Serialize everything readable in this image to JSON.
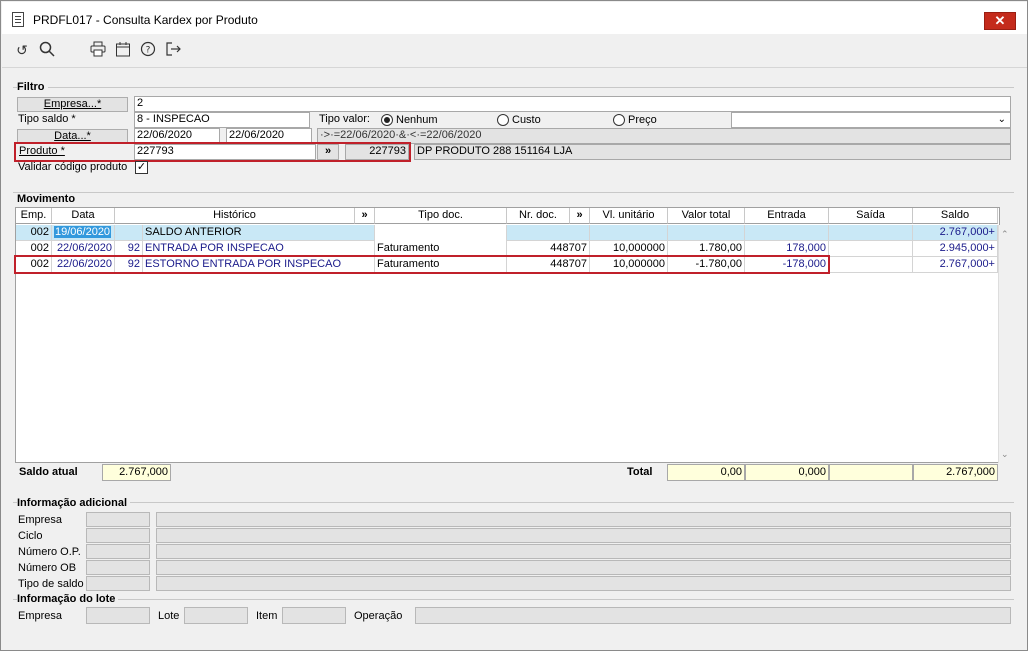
{
  "window": {
    "title": "PRDFL017 - Consulta Kardex por Produto",
    "close_glyph": "✕"
  },
  "toolbar": {
    "icons": [
      "undo-icon",
      "search-icon",
      "print-icon",
      "calendar-icon",
      "help-icon",
      "exit-icon"
    ]
  },
  "filtro": {
    "section_label": "Filtro",
    "empresa_button": "Empresa...*",
    "empresa_value": "2",
    "tipo_saldo_label": "Tipo saldo *",
    "tipo_saldo_value": "8 - INSPECAO",
    "tipo_valor_label": "Tipo valor:",
    "tipo_valor_options": [
      "Nenhum",
      "Custo",
      "Preço"
    ],
    "tipo_valor_selected": "Nenhum",
    "data_button": "Data...*",
    "data_inicio": "22/06/2020",
    "data_fim": "22/06/2020",
    "data_expr": "·>·=22/06/2020·&·<·=22/06/2020",
    "produto_label": "Produto *",
    "produto_value": "227793",
    "produto_btn": "»",
    "produto_code": "227793",
    "produto_desc": "DP PRODUTO 288 151164 LJA",
    "validar_label": "Validar código produto",
    "validar_checked": true
  },
  "movimento": {
    "section_label": "Movimento",
    "columns": [
      "Emp.",
      "Data",
      "Histórico",
      "»",
      "Tipo doc.",
      "Nr. doc.",
      "»",
      "Vl. unitário",
      "Valor total",
      "Entrada",
      "Saída",
      "Saldo"
    ],
    "rows": [
      {
        "emp": "002",
        "data": "19/06/2020",
        "hist_num": "",
        "historico": "SALDO ANTERIOR",
        "tipo_doc": "",
        "nr_doc": "",
        "vl_unit": "",
        "valor_total": "",
        "entrada": "",
        "saida": "",
        "saldo": "2.767,000+"
      },
      {
        "emp": "002",
        "data": "22/06/2020",
        "hist_num": "92",
        "historico": "ENTRADA POR INSPECAO",
        "tipo_doc": "Faturamento",
        "nr_doc": "448707",
        "vl_unit": "10,000000",
        "valor_total": "1.780,00",
        "entrada": "178,000",
        "saida": "",
        "saldo": "2.945,000+"
      },
      {
        "emp": "002",
        "data": "22/06/2020",
        "hist_num": "92",
        "historico": "ESTORNO ENTRADA POR INSPECAO",
        "tipo_doc": "Faturamento",
        "nr_doc": "448707",
        "vl_unit": "10,000000",
        "valor_total": "-1.780,00",
        "entrada": "-178,000",
        "saida": "",
        "saldo": "2.767,000+"
      }
    ],
    "saldo_atual_label": "Saldo atual",
    "saldo_atual_value": "2.767,000",
    "total_label": "Total",
    "total_valor": "0,00",
    "total_entrada": "0,000",
    "total_saida": "",
    "total_saldo": "2.767,000"
  },
  "info_adicional": {
    "section_label": "Informação adicional",
    "rows": [
      "Empresa",
      "Ciclo",
      "Número O.P.",
      "Número OB",
      "Tipo de saldo"
    ]
  },
  "info_lote": {
    "section_label": "Informação do lote",
    "empresa_label": "Empresa",
    "lote_label": "Lote",
    "item_label": "Item",
    "operacao_label": "Operação"
  },
  "colors": {
    "selected_row": "#c9e8f6",
    "highlight_box": "#c0202a",
    "total_fill": "#ffffdc",
    "data_text": "#1a1a8a"
  }
}
